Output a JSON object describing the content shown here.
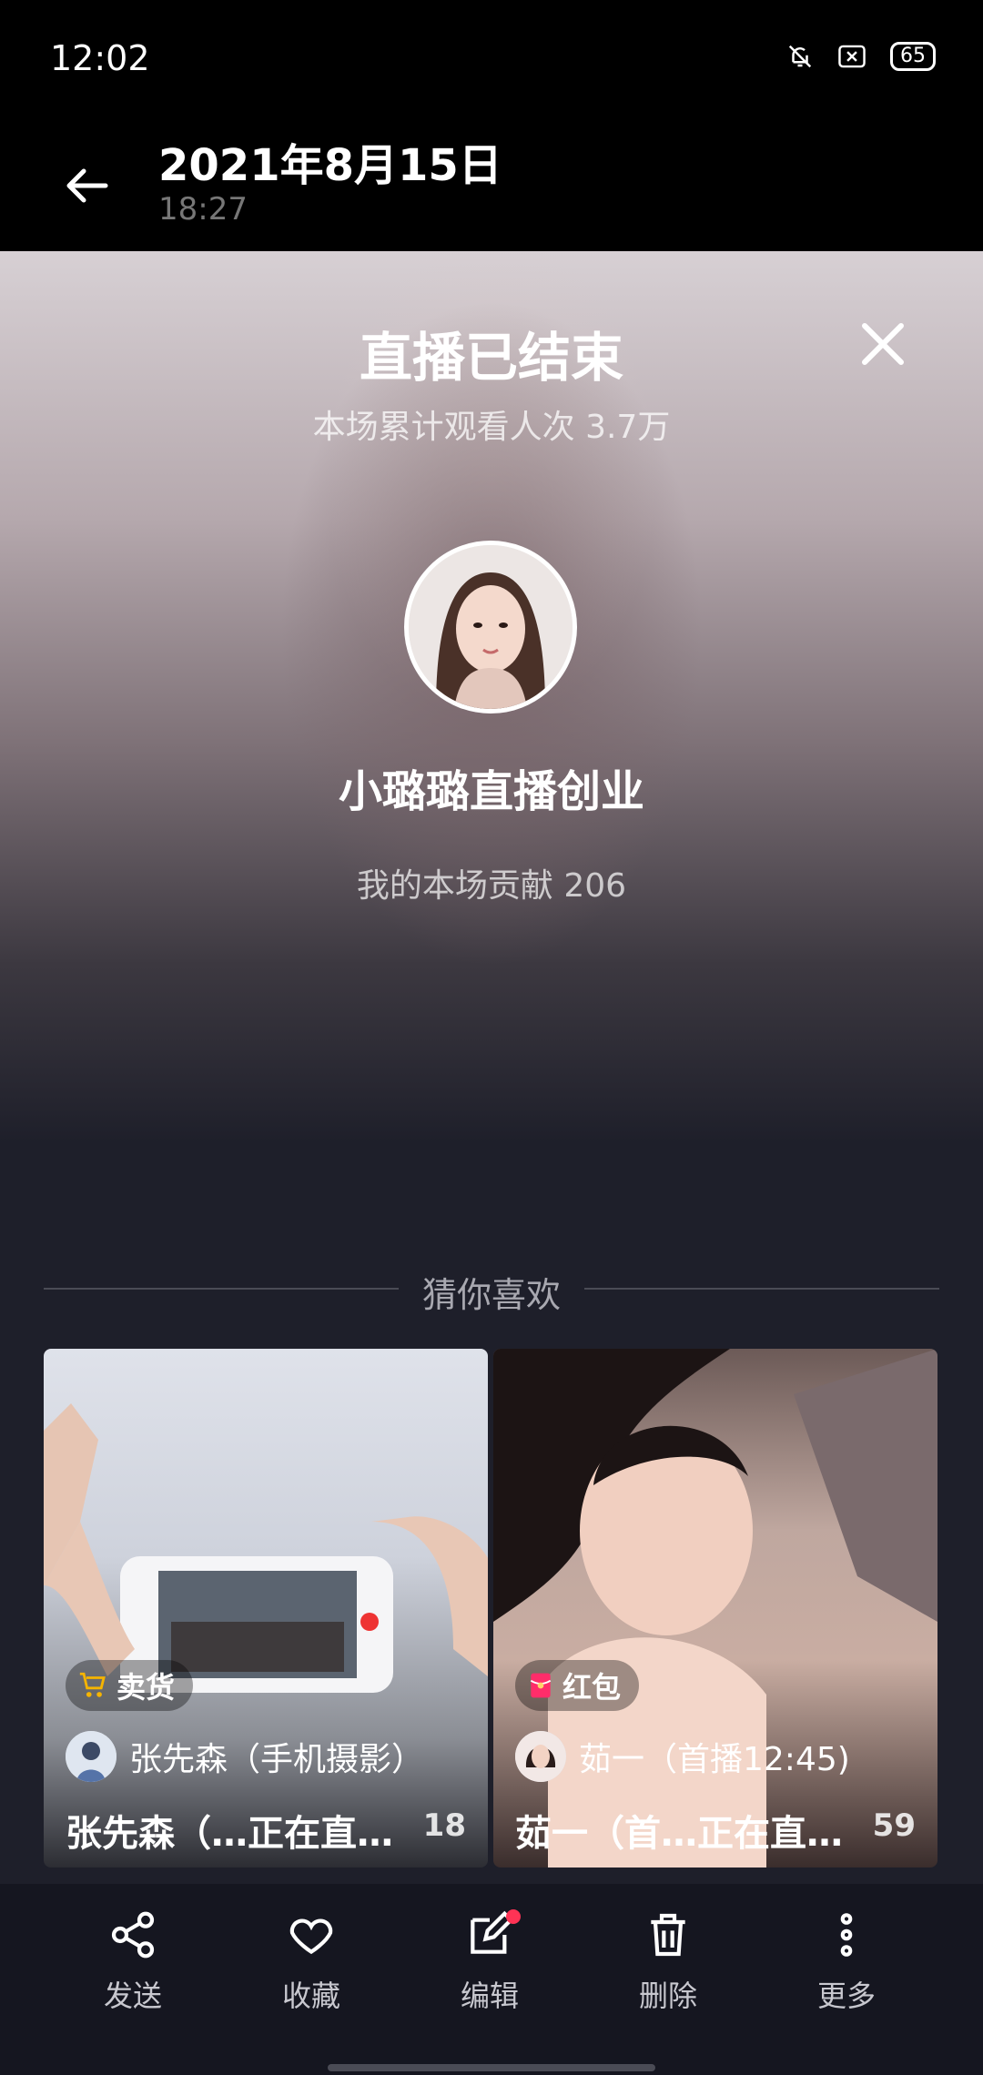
{
  "status_bar": {
    "time": "12:02",
    "battery": "65",
    "icons": [
      "bell-off-icon",
      "close-box-icon",
      "battery-icon"
    ]
  },
  "header": {
    "date": "2021年8月15日",
    "time": "18:27",
    "back_icon": "arrow-left-icon"
  },
  "live_end": {
    "title": "直播已结束",
    "viewers": "本场累计观看人次 3.7万",
    "host_name": "小璐璐直播创业",
    "contribution": "我的本场贡献 206",
    "close_icon": "close-icon"
  },
  "recommend": {
    "heading": "猜你喜欢",
    "cards": [
      {
        "badge": "卖货",
        "badge_icon": "cart-icon",
        "badge_color": "#f5b400",
        "author": "张先森（手机摄影）",
        "title": "张先森（…正在直…",
        "count": "18"
      },
      {
        "badge": "红包",
        "badge_icon": "red-envelope-icon",
        "badge_color": "#ff2d6a",
        "author": "茹一（首播12:45)",
        "title": "茹一（首…正在直…",
        "count": "59"
      }
    ]
  },
  "actions": [
    {
      "label": "发送",
      "icon": "share-icon"
    },
    {
      "label": "收藏",
      "icon": "heart-icon"
    },
    {
      "label": "编辑",
      "icon": "edit-icon"
    },
    {
      "label": "删除",
      "icon": "trash-icon"
    },
    {
      "label": "更多",
      "icon": "more-vertical-icon"
    }
  ],
  "colors": {
    "accent_dot": "#ff3355",
    "background": "#1e1f2a"
  }
}
